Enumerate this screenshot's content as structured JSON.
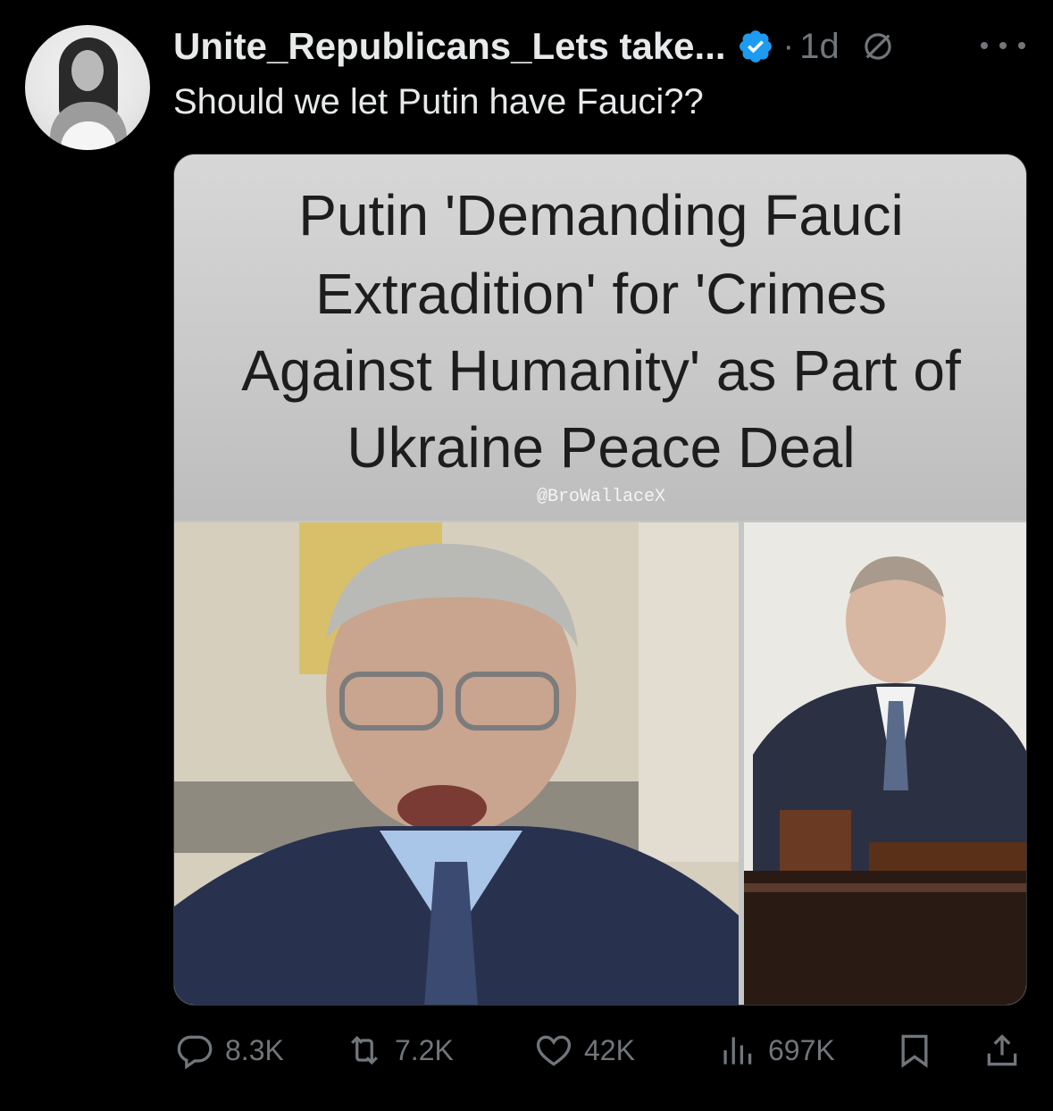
{
  "post": {
    "username": "Unite_Republicans_Lets take...",
    "verified_icon": "verified-badge-icon",
    "separator": "·",
    "timestamp": "1d",
    "no_edit_icon": "no-entry-icon",
    "more_icon": "more-options-icon",
    "text": "Should we let Putin have Fauci??"
  },
  "media": {
    "headline_lines": [
      "Putin 'Demanding Fauci",
      "Extradition' for 'Crimes",
      "Against Humanity' as Part of",
      "Ukraine Peace Deal"
    ],
    "credit": "@BroWallaceX"
  },
  "actions": {
    "reply_count": "8.3K",
    "retweet_count": "7.2K",
    "like_count": "42K",
    "view_count": "697K",
    "icons": [
      "reply-icon",
      "retweet-icon",
      "like-icon",
      "views-icon",
      "bookmark-icon",
      "share-icon"
    ]
  },
  "colors": {
    "background": "#000000",
    "text_primary": "#e7e9ea",
    "text_secondary": "#71767b",
    "verified_blue": "#1d9bf0"
  }
}
